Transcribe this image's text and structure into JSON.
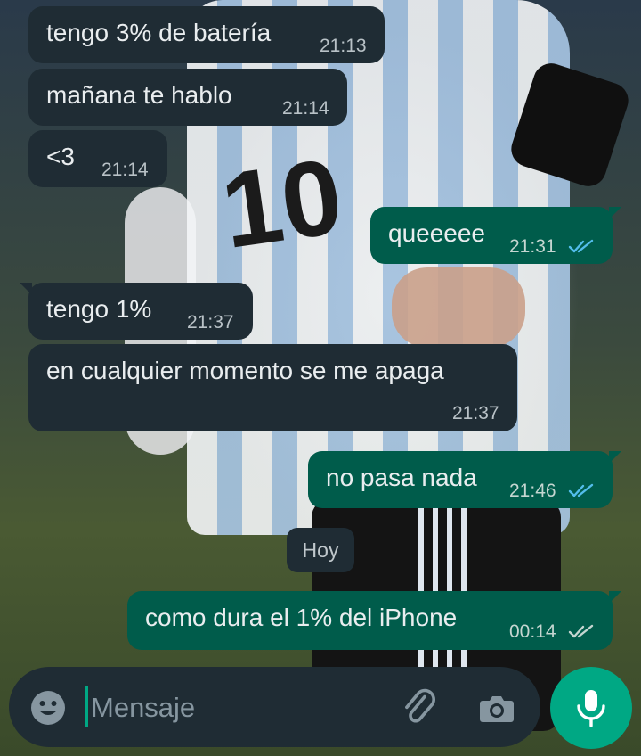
{
  "messages": [
    {
      "dir": "in",
      "text": "tengo 3% de batería",
      "time": "21:13"
    },
    {
      "dir": "in",
      "text": "mañana te hablo",
      "time": "21:14"
    },
    {
      "dir": "in",
      "text": "<3",
      "time": "21:14"
    },
    {
      "dir": "out",
      "text": "queeeee",
      "time": "21:31",
      "status": "read-double-check-icon"
    },
    {
      "dir": "in",
      "text": "tengo 1%",
      "time": "21:37"
    },
    {
      "dir": "in",
      "text": "en cualquier momento se me apaga",
      "time": "21:37"
    },
    {
      "dir": "out",
      "text": "no pasa nada",
      "time": "21:46",
      "status": "read-double-check-icon"
    },
    {
      "dir": "out",
      "text": "como dura el 1% del iPhone",
      "time": "00:14",
      "status": "delivered-double-check-icon"
    }
  ],
  "day_separator": "Hoy",
  "input": {
    "placeholder": "Mensaje",
    "value": ""
  },
  "icons": {
    "emoji": "emoji-icon",
    "attach": "paperclip-icon",
    "camera": "camera-icon",
    "mic": "microphone-icon"
  },
  "colors": {
    "incoming_bubble": "#1f2c34",
    "outgoing_bubble": "#005c4b",
    "accent": "#00a884",
    "read_ticks": "#53bdeb",
    "delivered_ticks": "#c5d6d1"
  }
}
